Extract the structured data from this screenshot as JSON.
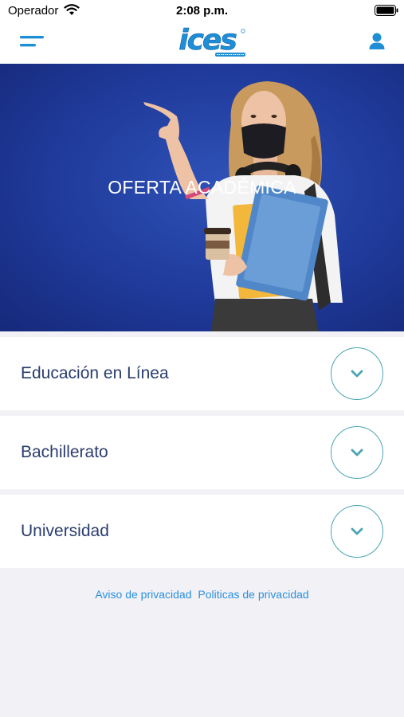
{
  "status_bar": {
    "carrier": "Operador",
    "time": "2:08 p.m.",
    "icons": [
      "wifi-icon",
      "battery-icon"
    ]
  },
  "header": {
    "menu_icon": "hamburger-menu-icon",
    "logo_text": "ices",
    "user_icon": "user-icon"
  },
  "hero": {
    "title": "OFERTA ACADÉMICA"
  },
  "accordion": {
    "items": [
      {
        "label": "Educación en Línea",
        "icon": "chevron-down-icon"
      },
      {
        "label": "Bachillerato",
        "icon": "chevron-down-icon"
      },
      {
        "label": "Universidad",
        "icon": "chevron-down-icon"
      }
    ]
  },
  "footer": {
    "privacy_notice": "Aviso de privacidad",
    "privacy_policies": "Politicas de privacidad"
  },
  "colors": {
    "brand_blue": "#1e8fd6",
    "hero_blue": "#1f3a9a",
    "accent_teal": "#4aa5b3",
    "label_navy": "#2a3d6e",
    "link_blue": "#2a8fe0",
    "page_bg": "#f2f2f6"
  }
}
